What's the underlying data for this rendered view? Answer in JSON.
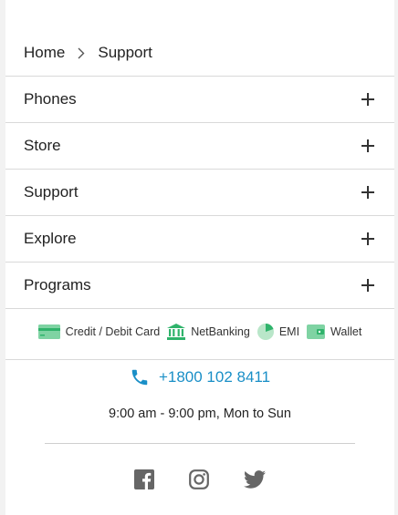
{
  "breadcrumb": {
    "home": "Home",
    "current": "Support"
  },
  "accordion": [
    {
      "label": "Phones"
    },
    {
      "label": "Store"
    },
    {
      "label": "Support"
    },
    {
      "label": "Explore"
    },
    {
      "label": "Programs"
    }
  ],
  "payments": {
    "card": "Credit / Debit Card",
    "netbanking": "NetBanking",
    "emi": "EMI",
    "wallet": "Wallet"
  },
  "contact": {
    "phone": "+1800 102 8411",
    "hours": "9:00 am - 9:00 pm, Mon to Sun"
  },
  "social": [
    "facebook-icon",
    "instagram-icon",
    "twitter-icon"
  ],
  "colors": {
    "accent": "#1a8fc7",
    "payment_green": "#2fb36b",
    "icon_gray": "#666666"
  }
}
